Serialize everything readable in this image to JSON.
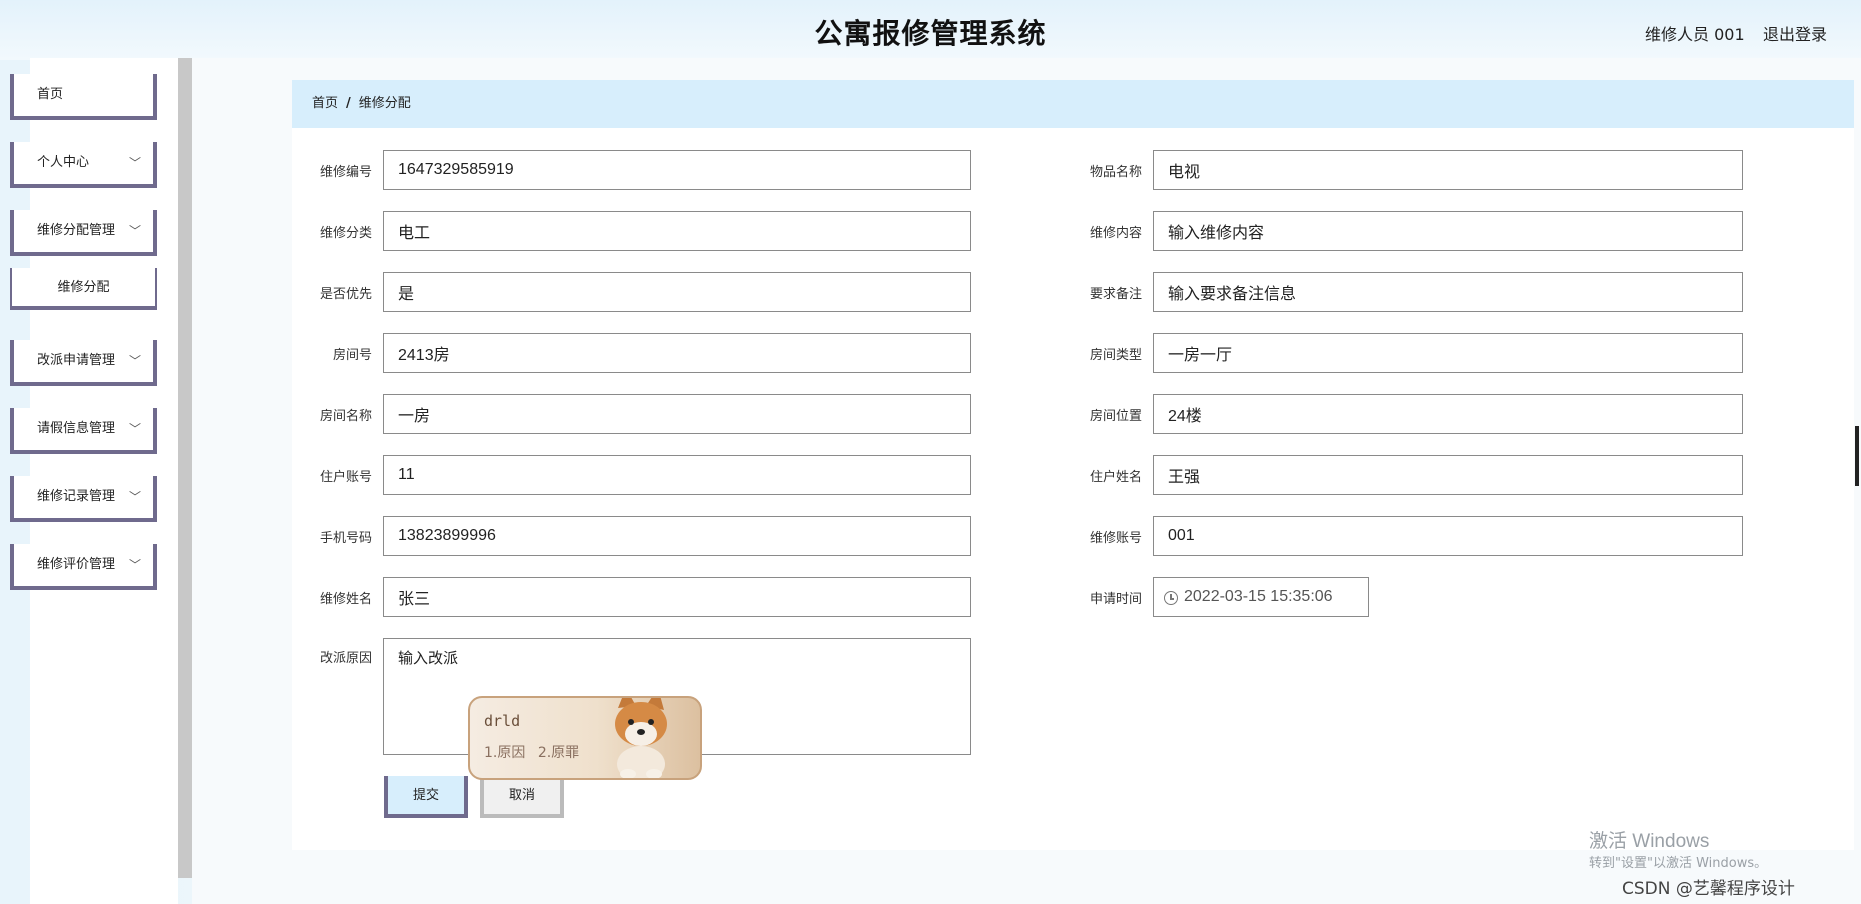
{
  "header": {
    "title": "公寓报修管理系统",
    "user": "维修人员 001",
    "logout": "退出登录"
  },
  "sidebar": {
    "items": [
      {
        "label": "首页"
      },
      {
        "label": "个人中心"
      },
      {
        "label": "维修分配管理"
      },
      {
        "label": "维修分配"
      },
      {
        "label": "改派申请管理"
      },
      {
        "label": "请假信息管理"
      },
      {
        "label": "维修记录管理"
      },
      {
        "label": "维修评价管理"
      }
    ]
  },
  "breadcrumb": {
    "home": "首页",
    "separator": "/",
    "current": "维修分配"
  },
  "form": {
    "fields": [
      {
        "label": "维修编号",
        "value": "1647329585919"
      },
      {
        "label": "物品名称",
        "value": "电视"
      },
      {
        "label": "维修分类",
        "value": "电工"
      },
      {
        "label": "维修内容",
        "value": "输入维修内容"
      },
      {
        "label": "是否优先",
        "value": "是"
      },
      {
        "label": "要求备注",
        "value": "输入要求备注信息"
      },
      {
        "label": "房间号",
        "value": "2413房"
      },
      {
        "label": "房间类型",
        "value": "一房一厅"
      },
      {
        "label": "房间名称",
        "value": "一房"
      },
      {
        "label": "房间位置",
        "value": "24楼"
      },
      {
        "label": "住户账号",
        "value": "11"
      },
      {
        "label": "住户姓名",
        "value": "王强"
      },
      {
        "label": "手机号码",
        "value": "13823899996"
      },
      {
        "label": "维修账号",
        "value": "001"
      },
      {
        "label": "维修姓名",
        "value": "张三"
      },
      {
        "label": "申请时间",
        "value": "2022-03-15 15:35:06"
      },
      {
        "label": "改派原因",
        "value": "输入改派"
      }
    ],
    "submit": "提交",
    "cancel": "取消"
  },
  "ime": {
    "input": "drld",
    "candidate1": "1.原因",
    "candidate2": "2.原罪"
  },
  "overlay": {
    "activate_title": "激活 Windows",
    "activate_hint": "转到\"设置\"以激活 Windows。",
    "csdn": "CSDN @艺馨程序设计"
  }
}
